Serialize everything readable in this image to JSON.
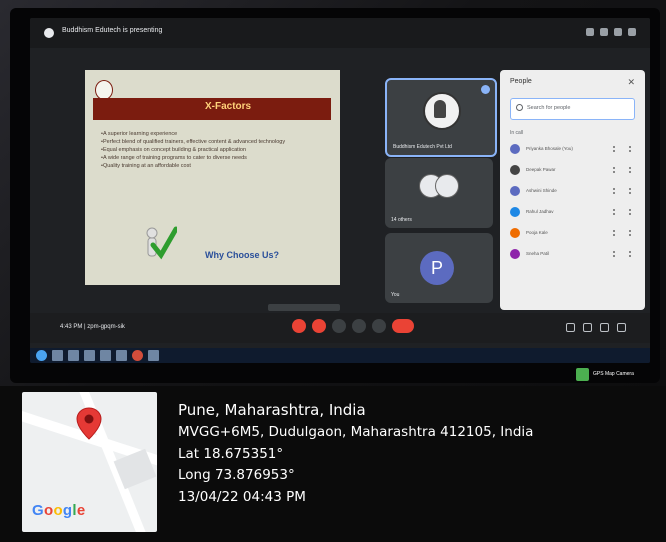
{
  "meet": {
    "presenting_title": "Buddhism Edutech is presenting",
    "time_code": "4:43 PM | zpm-gpqm-sik",
    "people_title": "People",
    "people_search_placeholder": "Search for people",
    "people_section": "In call",
    "participants": [
      {
        "name": "Priyanka Bhosale (You)",
        "color": "#5c6bc0"
      },
      {
        "name": "Deepak Pawar",
        "color": "#444444"
      },
      {
        "name": "Ashwini Shinde",
        "color": "#5c6bc0"
      },
      {
        "name": "Rahul Jadhav",
        "color": "#1e88e5"
      },
      {
        "name": "Pooja Kale",
        "color": "#ef6c00"
      },
      {
        "name": "Sneha Patil",
        "color": "#8e24aa"
      }
    ],
    "tiles": {
      "presenter_name": "Buddhism Edutech Pvt Ltd",
      "others_label": "14 others",
      "you_initial": "P",
      "you_label": "You"
    }
  },
  "slide": {
    "title": "X-Factors",
    "bullets": [
      "A superior learning experience",
      "Perfect blend of qualified trainers, effective content & advanced technology",
      "Equal emphasis on concept building & practical application",
      "A wide range of training programs to cater to diverse needs",
      "Quality training at an affordable cost"
    ],
    "tagline": "Why Choose Us?"
  },
  "gps": {
    "app_name": "GPS Map Camera",
    "city": "Pune, Maharashtra, India",
    "address": "MVGG+6M5, Dudulgaon, Maharashtra 412105, India",
    "lat": "Lat 18.675351°",
    "long": "Long 73.876953°",
    "datetime": "13/04/22 04:43 PM",
    "map_brand": [
      "G",
      "o",
      "o",
      "g",
      "l",
      "e"
    ],
    "pin_color": "#e53935"
  }
}
